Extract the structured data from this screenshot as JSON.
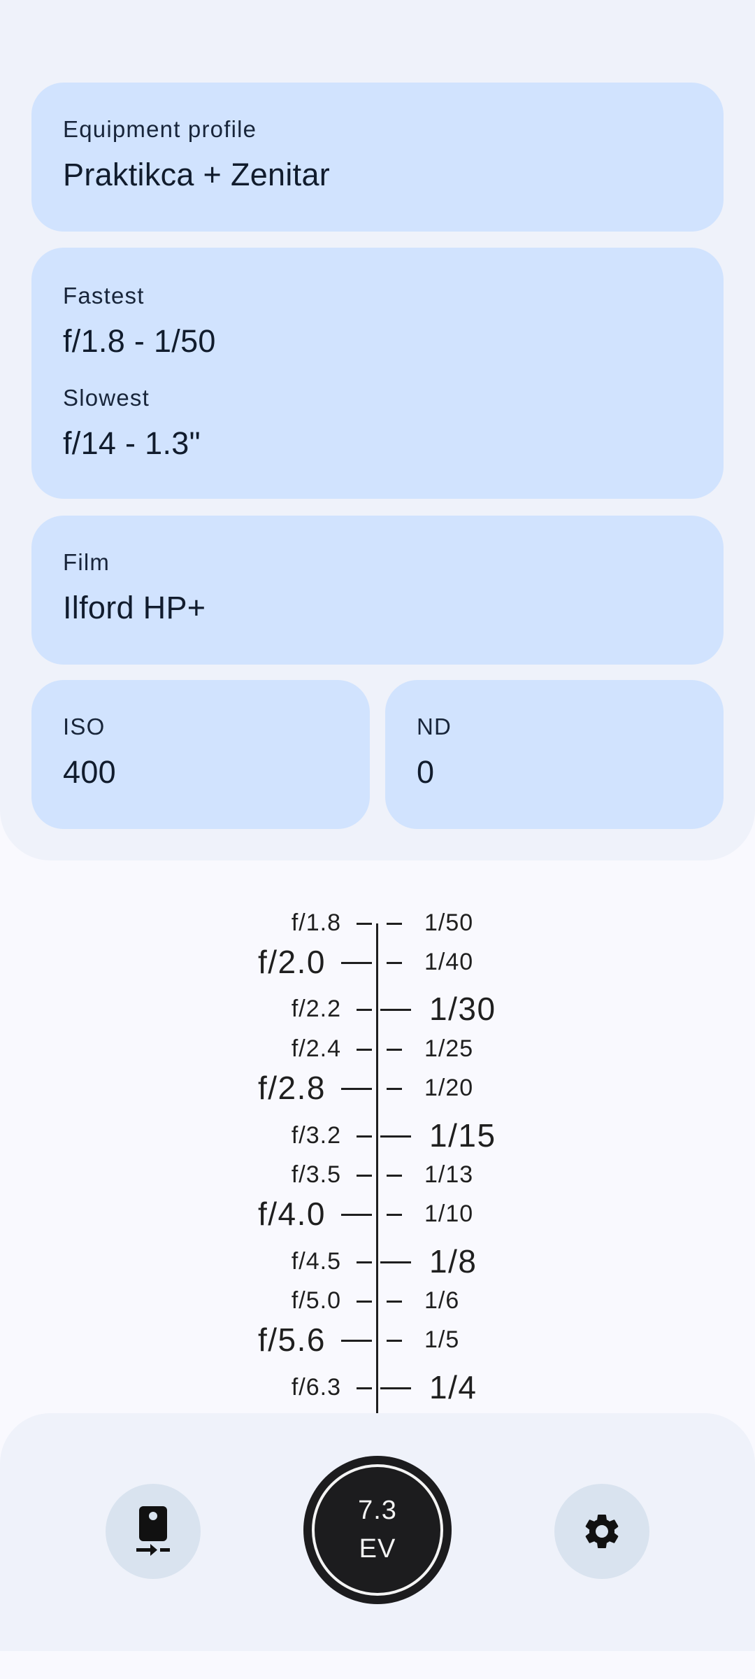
{
  "equipment": {
    "label": "Equipment profile",
    "value": "Praktikca + Zenitar"
  },
  "range": {
    "fastest_label": "Fastest",
    "fastest_value": "f/1.8 - 1/50",
    "slowest_label": "Slowest",
    "slowest_value": "f/14 - 1.3\""
  },
  "film": {
    "label": "Film",
    "value": "Ilford HP+"
  },
  "iso": {
    "label": "ISO",
    "value": "400"
  },
  "nd": {
    "label": "ND",
    "value": "0"
  },
  "scale": {
    "apertures": [
      {
        "label": "f/1.8",
        "major": false
      },
      {
        "label": "f/2.0",
        "major": true
      },
      {
        "label": "f/2.2",
        "major": false
      },
      {
        "label": "f/2.4",
        "major": false
      },
      {
        "label": "f/2.8",
        "major": true
      },
      {
        "label": "f/3.2",
        "major": false
      },
      {
        "label": "f/3.5",
        "major": false
      },
      {
        "label": "f/4.0",
        "major": true
      },
      {
        "label": "f/4.5",
        "major": false
      },
      {
        "label": "f/5.0",
        "major": false
      },
      {
        "label": "f/5.6",
        "major": true
      },
      {
        "label": "f/6.3",
        "major": false
      }
    ],
    "shutter_speeds": [
      {
        "label": "1/50",
        "major": false
      },
      {
        "label": "1/40",
        "major": false
      },
      {
        "label": "1/30",
        "major": true
      },
      {
        "label": "1/25",
        "major": false
      },
      {
        "label": "1/20",
        "major": false
      },
      {
        "label": "1/15",
        "major": true
      },
      {
        "label": "1/13",
        "major": false
      },
      {
        "label": "1/10",
        "major": false
      },
      {
        "label": "1/8",
        "major": true
      },
      {
        "label": "1/6",
        "major": false
      },
      {
        "label": "1/5",
        "major": false
      },
      {
        "label": "1/4",
        "major": true
      }
    ]
  },
  "bottom": {
    "ev_value": "7.3",
    "ev_unit": "EV",
    "left_icon": "light-meter-icon",
    "right_icon": "gear-icon"
  },
  "colors": {
    "card": "#d1e3fe",
    "panel": "#eff2fa",
    "background": "#f9f9fe",
    "ev_button": "#1c1c1e"
  }
}
